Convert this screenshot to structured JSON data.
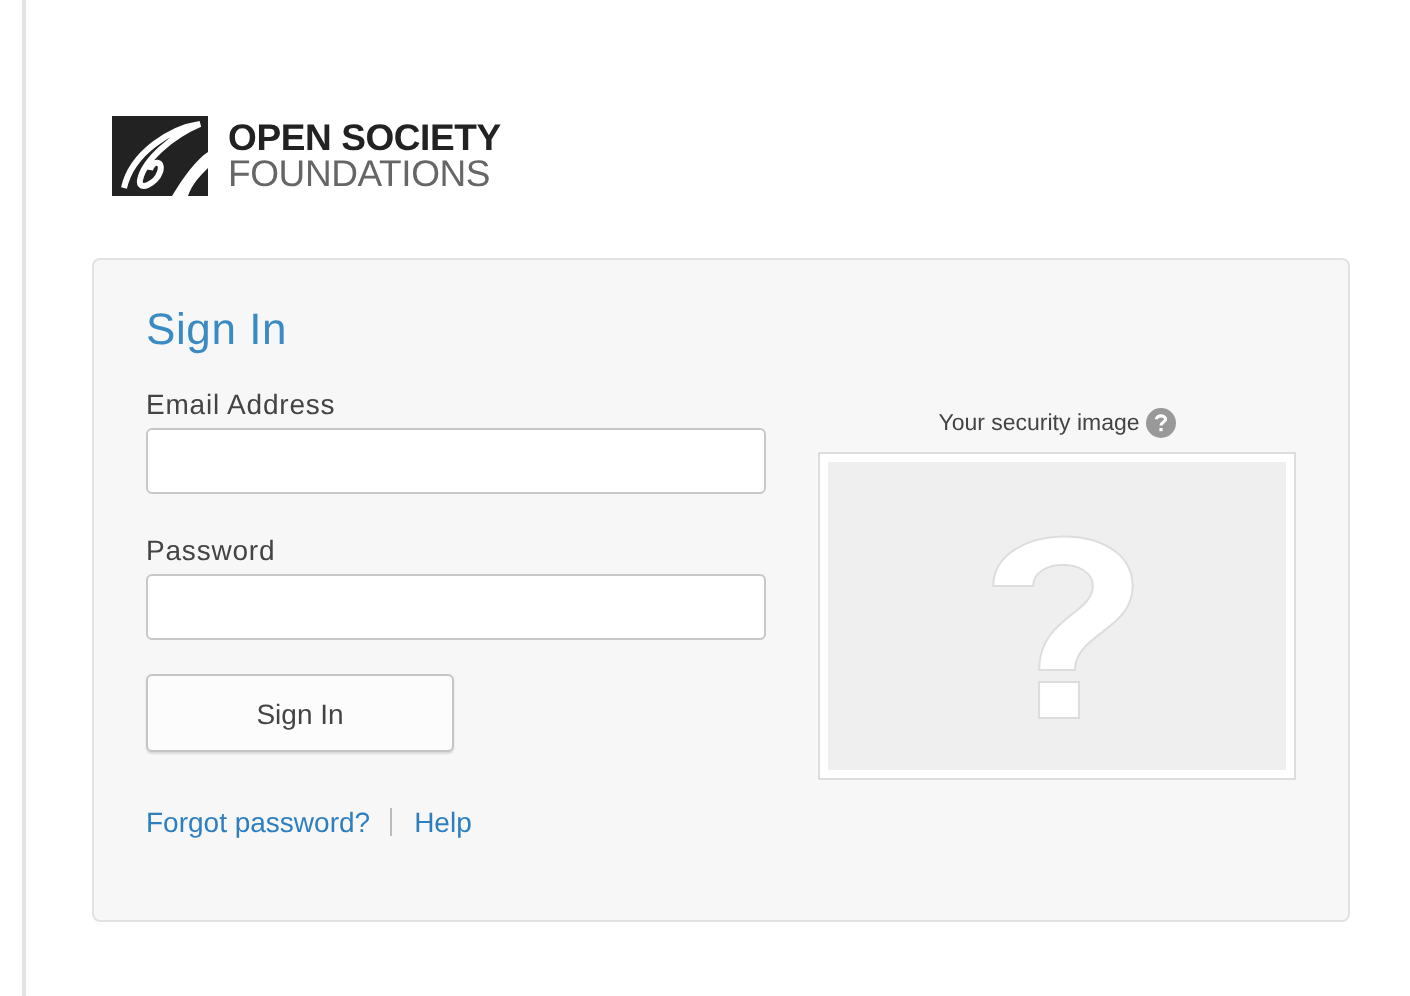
{
  "logo": {
    "line_1": "OPEN SOCIETY",
    "line_2": "FOUNDATIONS"
  },
  "sign_in": {
    "title": "Sign In",
    "fields": [
      {
        "label": "Email Address"
      },
      {
        "label": "Password"
      }
    ],
    "button": "Sign In",
    "links": [
      "Forgot password?",
      "Help"
    ],
    "security_image": {
      "label": "Your security image",
      "kind": "picture"
    }
  }
}
